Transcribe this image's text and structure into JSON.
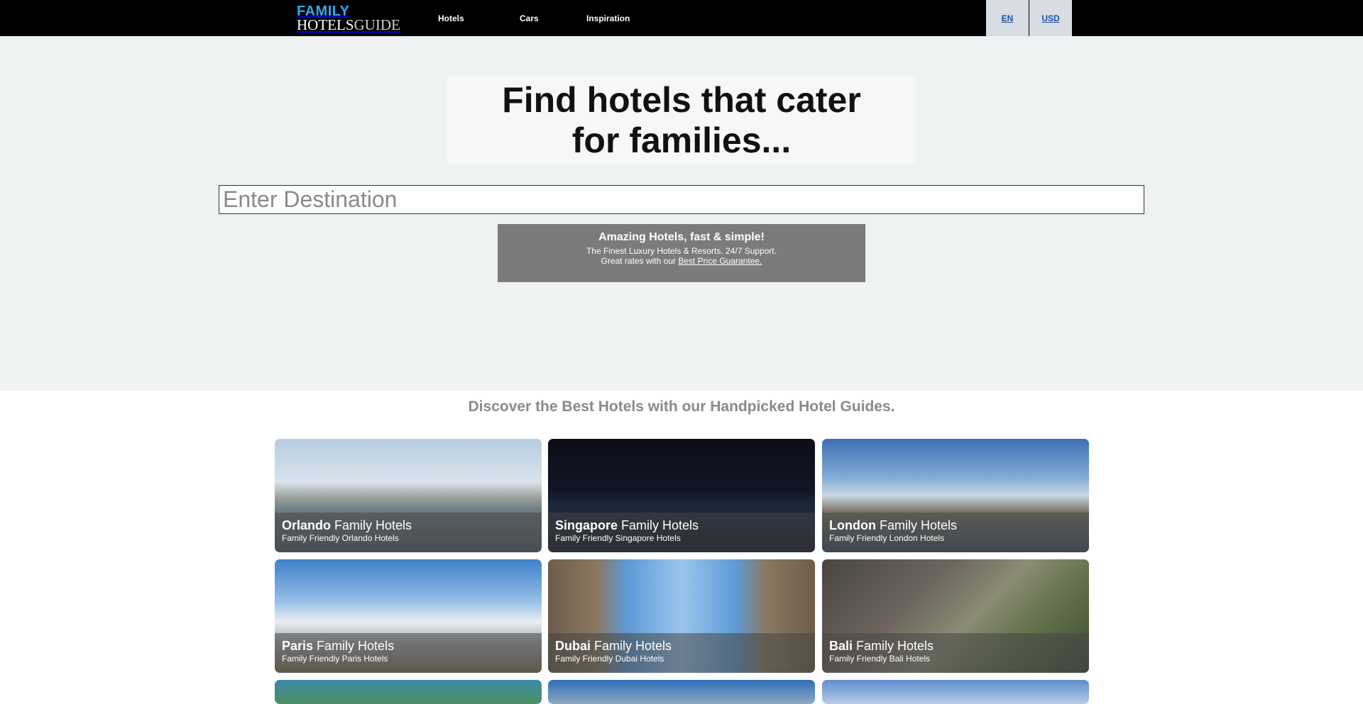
{
  "header": {
    "logo_line1": "FAMILY",
    "logo_line2a": "HOTELS",
    "logo_line2b": "GUIDE",
    "nav": {
      "hotels": "Hotels",
      "cars": "Cars",
      "inspiration": "Inspiration"
    },
    "language": "EN",
    "currency": "USD"
  },
  "hero": {
    "headline": "Find hotels that cater for families...",
    "destination_placeholder": "Enter Destination",
    "promo_title": "Amazing Hotels, fast & simple!",
    "promo_line1": "The Finest Luxury Hotels & Resorts. 24/7 Support.",
    "promo_line2_prefix": "Great rates with our ",
    "promo_link": "Best Price Guarantee."
  },
  "discover": {
    "heading": "Discover the Best Hotels with our Handpicked Hotel Guides.",
    "cards": [
      {
        "city": "Orlando",
        "suffix": " Family Hotels",
        "subtitle": "Family Friendly Orlando Hotels"
      },
      {
        "city": "Singapore",
        "suffix": " Family Hotels",
        "subtitle": "Family Friendly Singapore Hotels"
      },
      {
        "city": "London",
        "suffix": " Family Hotels",
        "subtitle": "Family Friendly London Hotels"
      },
      {
        "city": "Paris",
        "suffix": " Family Hotels",
        "subtitle": "Family Friendly Paris Hotels"
      },
      {
        "city": "Dubai",
        "suffix": " Family Hotels",
        "subtitle": "Family Friendly Dubai Hotels"
      },
      {
        "city": "Bali",
        "suffix": " Family Hotels",
        "subtitle": "Family Friendly Bali Hotels"
      }
    ]
  },
  "colors": {
    "header_bg": "#000000",
    "logo_accent": "#35a7ee",
    "hero_bg": "#eef2f2",
    "promo_bg": "#7b7b7b"
  }
}
